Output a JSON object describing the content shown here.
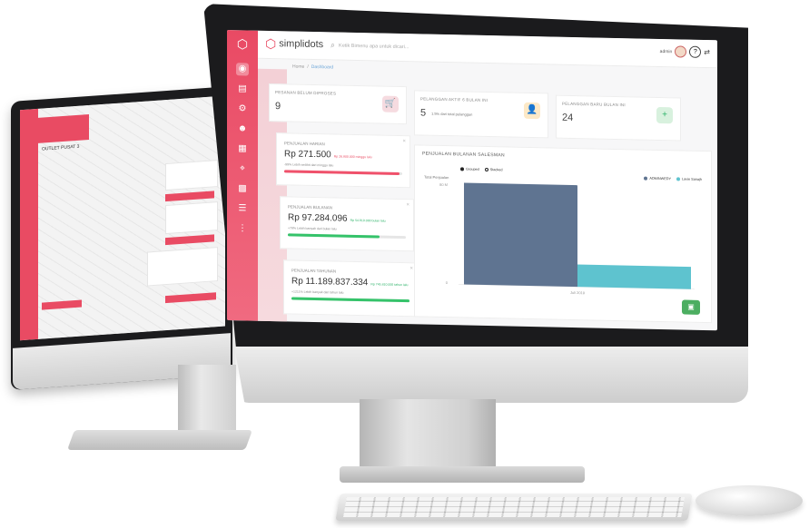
{
  "app": {
    "brand": "simplidots",
    "search_placeholder": "Ketik Bimenu apa untuk dicari...",
    "user_name": "admin"
  },
  "breadcrumb": {
    "home": "Home",
    "separator": "/",
    "current": "Dashboard"
  },
  "stats": [
    {
      "label": "Pesanan Belum Diproses",
      "value": "9",
      "icon": "cart-icon",
      "color": "#f6dbe0",
      "fg": "#e94b63"
    },
    {
      "label": "Pelanggan Aktif 6 Bulan Ini",
      "value": "5",
      "sub": "1.5% dari total pelanggan",
      "icon": "person-icon",
      "color": "#fde9c7",
      "fg": "#f5a623"
    },
    {
      "label": "Pelanggan Baru Bulan Ini",
      "value": "24",
      "icon": "person-add-icon",
      "color": "#d8f1de",
      "fg": "#2fb36a"
    }
  ],
  "sales": [
    {
      "label": "Penjualan Harian",
      "value": "Rp 271.500",
      "period": "Rp 26.800.000 minggu lalu",
      "trend": "-99% Lebih sedikit dari minggu lalu",
      "progress": 0.98,
      "color": "#f0516b",
      "pclass": ""
    },
    {
      "label": "Penjualan Bulanan",
      "value": "Rp 97.284.096",
      "period": "Rp 54.910.000 bulan lalu",
      "trend": "+78% Lebih banyak dari bulan lalu",
      "progress": 0.78,
      "color": "#35c36a",
      "pclass": "g"
    },
    {
      "label": "Penjualan Tahunan",
      "value": "Rp 11.189.837.334",
      "period": "Rp 745.810.000 tahun lalu",
      "trend": "+1211% Lebih banyak dari tahun lalu",
      "progress": 1.0,
      "color": "#35c36a",
      "pclass": "g"
    }
  ],
  "chart_data": {
    "type": "bar",
    "title": "Penjualan Bulanan Salesman",
    "toggles": [
      "Grouped",
      "Stacked"
    ],
    "series": [
      {
        "name": "ADMINWEDY",
        "color": "#5f7491",
        "values": [
          1000
        ]
      },
      {
        "name": "Lavie Sanajh",
        "color": "#5ec3cf",
        "values": [
          220
        ]
      }
    ],
    "categories": [
      "Juli 2019"
    ],
    "ylabel": "Total Penjualan",
    "ylim": [
      0,
      1000
    ],
    "yticks": [
      "80 M",
      "0"
    ]
  },
  "second_monitor": {
    "panel_label": "OUTLET PUSAT 3"
  }
}
